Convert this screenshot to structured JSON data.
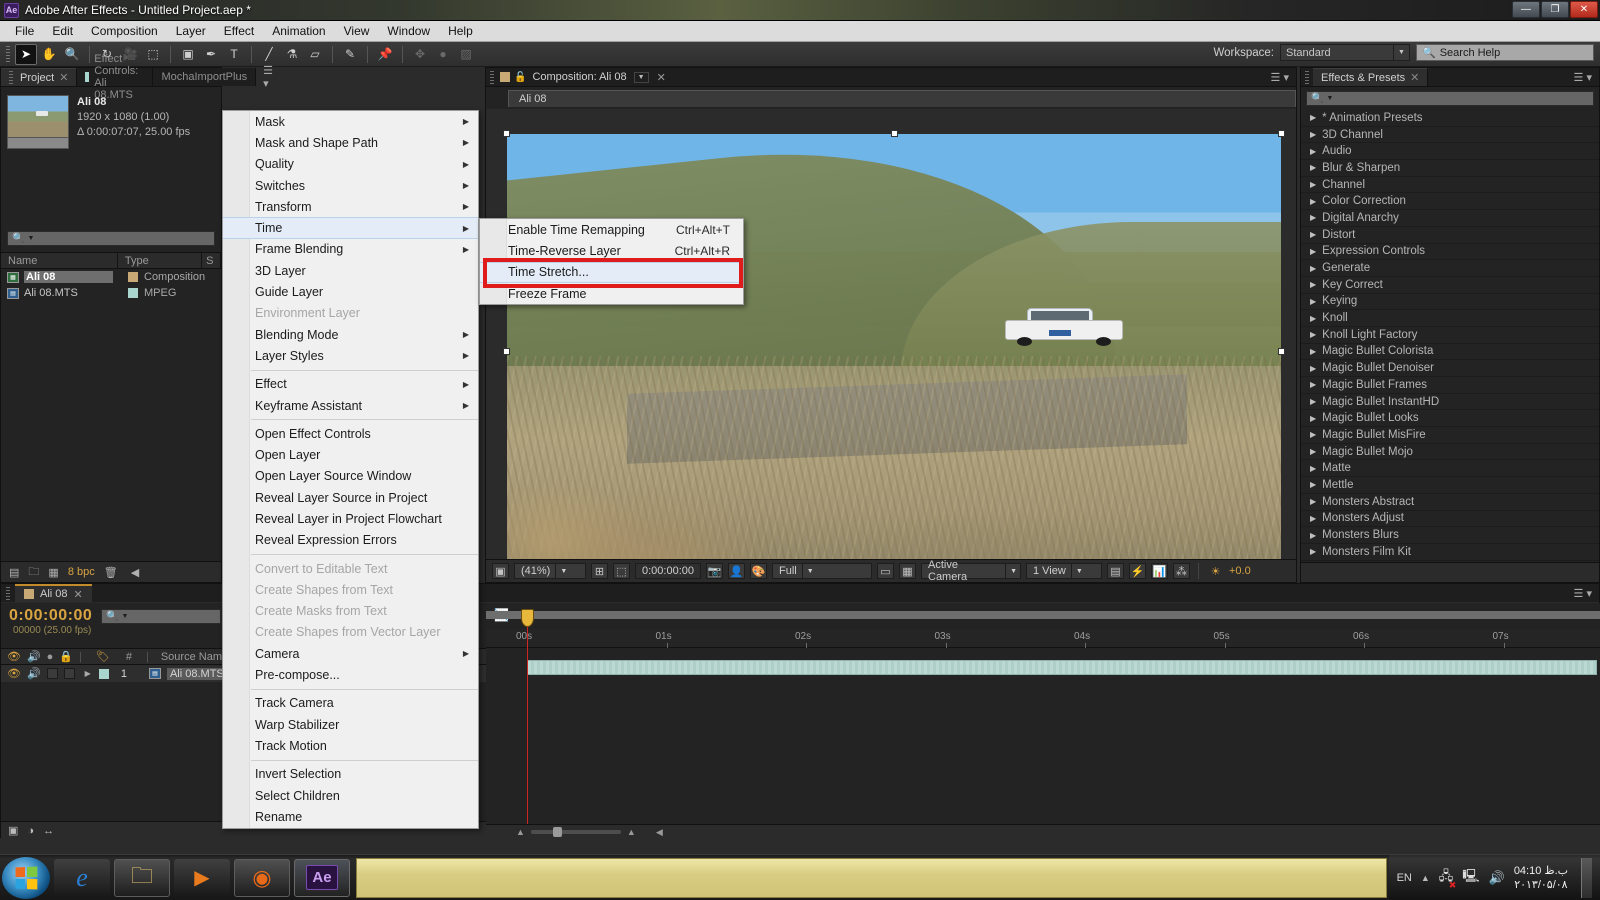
{
  "window": {
    "title": "Adobe After Effects - Untitled Project.aep *",
    "app_badge": "Ae",
    "minimize": "—",
    "maximize": "❐",
    "close": "✕"
  },
  "menubar": {
    "items": [
      "File",
      "Edit",
      "Composition",
      "Layer",
      "Effect",
      "Animation",
      "View",
      "Window",
      "Help"
    ]
  },
  "toolbar": {
    "workspace_label": "Workspace:",
    "workspace_value": "Standard",
    "search_help_placeholder": "Search Help",
    "search_help_value": "Search Help"
  },
  "project_panel": {
    "tabs": [
      {
        "label": "Project",
        "selected": true,
        "closable": true
      },
      {
        "label": "Effect Controls: Ali 08.MTS",
        "selected": false,
        "closable": false
      },
      {
        "label": "MochaImportPlus",
        "selected": false,
        "closable": false
      }
    ],
    "item_name": "Ali 08",
    "item_resolution": "1920 x 1080 (1.00)",
    "item_duration": "Δ 0:00:07:07, 25.00 fps",
    "search_placeholder": "",
    "columns": [
      "Name",
      "Type",
      "S"
    ],
    "rows": [
      {
        "name": "Ali 08",
        "type": "Composition",
        "selected": true,
        "swatch": "#c8a875"
      },
      {
        "name": "Ali 08.MTS",
        "type": "MPEG",
        "selected": false,
        "swatch": "#a8d6cf"
      }
    ],
    "footer": {
      "bit_depth": "8 bpc"
    }
  },
  "composition_panel": {
    "tab_label": "Composition: Ali 08",
    "sub_tab": "Ali 08",
    "bottom_bar": {
      "zoom": "(41%)",
      "time": "0:00:00:00",
      "resolution": "Full",
      "camera": "Active Camera",
      "views": "1 View",
      "exposure": "+0.0"
    }
  },
  "effects_panel": {
    "tab_label": "Effects & Presets",
    "search_placeholder": "",
    "items": [
      "* Animation Presets",
      "3D Channel",
      "Audio",
      "Blur & Sharpen",
      "Channel",
      "Color Correction",
      "Digital Anarchy",
      "Distort",
      "Expression Controls",
      "Generate",
      "Key Correct",
      "Keying",
      "Knoll",
      "Knoll Light Factory",
      "Magic Bullet Colorista",
      "Magic Bullet Denoiser",
      "Magic Bullet Frames",
      "Magic Bullet InstantHD",
      "Magic Bullet Looks",
      "Magic Bullet MisFire",
      "Magic Bullet Mojo",
      "Matte",
      "Mettle",
      "Monsters Abstract",
      "Monsters Adjust",
      "Monsters Blurs",
      "Monsters Film Kit"
    ]
  },
  "timeline_panel": {
    "tab_label": "Ali 08",
    "current_time": "0:00:00:00",
    "current_frame": "00000 (25.00 fps)",
    "search_placeholder": "",
    "column_header": "Source Name",
    "column_hash": "#",
    "layers": [
      {
        "index": "1",
        "name": "Ali 08.MTS"
      }
    ],
    "ruler_ticks": [
      "00s",
      "01s",
      "02s",
      "03s",
      "04s",
      "05s",
      "06s",
      "07s"
    ]
  },
  "context_menu": {
    "items": [
      {
        "label": "Mask",
        "submenu": true
      },
      {
        "label": "Mask and Shape Path",
        "submenu": true
      },
      {
        "label": "Quality",
        "submenu": true
      },
      {
        "label": "Switches",
        "submenu": true
      },
      {
        "label": "Transform",
        "submenu": true
      },
      {
        "label": "Time",
        "submenu": true,
        "highlighted": true
      },
      {
        "label": "Frame Blending",
        "submenu": true
      },
      {
        "label": "3D Layer",
        "submenu": false
      },
      {
        "label": "Guide Layer",
        "submenu": false
      },
      {
        "label": "Environment Layer",
        "submenu": false,
        "disabled": true
      },
      {
        "label": "Blending Mode",
        "submenu": true
      },
      {
        "label": "Layer Styles",
        "submenu": true
      },
      {
        "separator": true
      },
      {
        "label": "Effect",
        "submenu": true
      },
      {
        "label": "Keyframe Assistant",
        "submenu": true
      },
      {
        "separator": true
      },
      {
        "label": "Open Effect Controls",
        "submenu": false
      },
      {
        "label": "Open Layer",
        "submenu": false
      },
      {
        "label": "Open Layer Source Window",
        "submenu": false
      },
      {
        "label": "Reveal Layer Source in Project",
        "submenu": false
      },
      {
        "label": "Reveal Layer in Project Flowchart",
        "submenu": false
      },
      {
        "label": "Reveal Expression Errors",
        "submenu": false
      },
      {
        "separator": true
      },
      {
        "label": "Convert to Editable Text",
        "submenu": false,
        "disabled": true
      },
      {
        "label": "Create Shapes from Text",
        "submenu": false,
        "disabled": true
      },
      {
        "label": "Create Masks from Text",
        "submenu": false,
        "disabled": true
      },
      {
        "label": "Create Shapes from Vector Layer",
        "submenu": false,
        "disabled": true
      },
      {
        "label": "Camera",
        "submenu": true
      },
      {
        "label": "Pre-compose...",
        "submenu": false
      },
      {
        "separator": true
      },
      {
        "label": "Track Camera",
        "submenu": false
      },
      {
        "label": "Warp Stabilizer",
        "submenu": false
      },
      {
        "label": "Track Motion",
        "submenu": false
      },
      {
        "separator": true
      },
      {
        "label": "Invert Selection",
        "submenu": false
      },
      {
        "label": "Select Children",
        "submenu": false
      },
      {
        "label": "Rename",
        "submenu": false
      }
    ]
  },
  "time_submenu": {
    "items": [
      {
        "label": "Enable Time Remapping",
        "shortcut": "Ctrl+Alt+T"
      },
      {
        "label": "Time-Reverse Layer",
        "shortcut": "Ctrl+Alt+R"
      },
      {
        "label": "Time Stretch...",
        "shortcut": "",
        "highlighted": true
      },
      {
        "label": "Freeze Frame",
        "shortcut": ""
      }
    ],
    "highlight_color": "#e01b1b"
  },
  "taskbar": {
    "language": "EN",
    "clock_time": "04:10 ب.ظ",
    "clock_date": "۲۰۱۳/۰۵/۰۸",
    "items": [
      {
        "name": "internet-explorer",
        "glyph": "e"
      },
      {
        "name": "windows-explorer",
        "glyph": "🗀"
      },
      {
        "name": "media-player",
        "glyph": "▶"
      },
      {
        "name": "firefox",
        "glyph": "◉"
      },
      {
        "name": "after-effects",
        "glyph": "Ae"
      }
    ],
    "active_window_label": ""
  }
}
